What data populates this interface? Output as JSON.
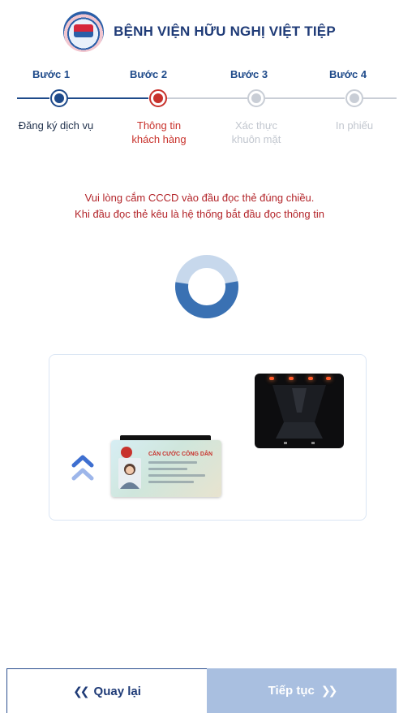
{
  "header": {
    "hospital_name": "BỆNH VIỆN HỮU NGHỊ VIỆT TIỆP",
    "logo_icon": "hospital-logo"
  },
  "stepper": {
    "steps": [
      {
        "title": "Bước 1",
        "desc_line1": "Đăng ký dịch vụ",
        "desc_line2": "",
        "state": "done"
      },
      {
        "title": "Bước 2",
        "desc_line1": "Thông tin",
        "desc_line2": "khách hàng",
        "state": "active"
      },
      {
        "title": "Bước 3",
        "desc_line1": "Xác thực",
        "desc_line2": "khuôn mặt",
        "state": "pending"
      },
      {
        "title": "Bước 4",
        "desc_line1": "In phiếu",
        "desc_line2": "",
        "state": "pending"
      }
    ],
    "colors": {
      "done": "#1e4a8a",
      "active": "#c8322c",
      "pending": "#c9ced6",
      "pending_text": "#c2c7cf"
    }
  },
  "instruction": {
    "line1": "Vui lòng cắm CCCD vào đầu đọc thẻ đúng chiều.",
    "line2": "Khi đầu đọc thẻ kêu là hệ thống bắt đầu đọc thông tin"
  },
  "spinner": {
    "progress": 0.55,
    "color": "#3a71b3",
    "track_color": "#c7d8ec"
  },
  "illustration": {
    "card_title": "CĂN CƯỚC CÔNG DÂN",
    "icons": [
      "id-card-reader",
      "citizen-id-card",
      "double-chevron-up-icon"
    ]
  },
  "footer": {
    "back_label": "Quay lại",
    "next_label": "Tiếp tục",
    "back_icon": "double-chevron-left-icon",
    "next_icon": "double-chevron-right-icon",
    "primary_color": "#1f3b77",
    "next_bg": "#a9bfe0"
  }
}
